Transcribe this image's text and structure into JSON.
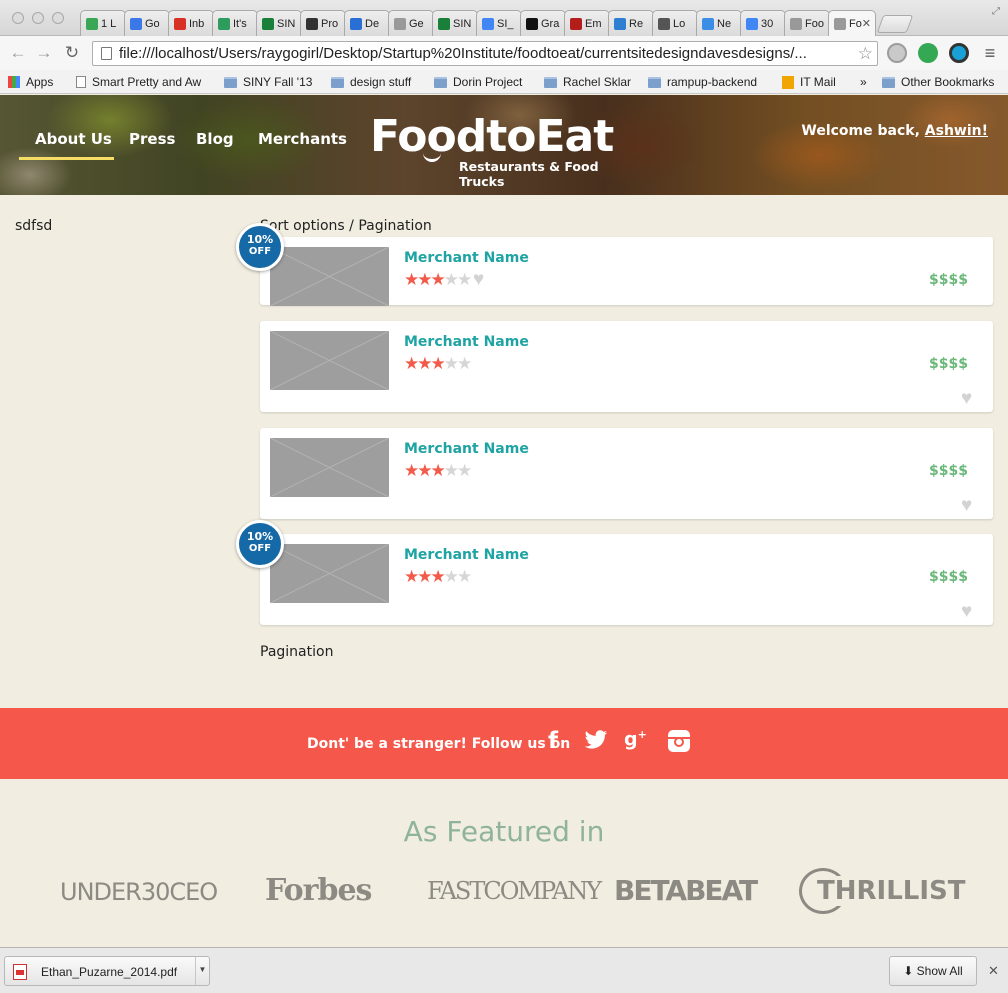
{
  "browser": {
    "tabs": [
      {
        "label": "1 L",
        "icon": "maps-icon",
        "color": "#3aa757"
      },
      {
        "label": "Go",
        "icon": "calendar-icon",
        "color": "#3b78e7"
      },
      {
        "label": "Inb",
        "icon": "gmail-icon",
        "color": "#d93025"
      },
      {
        "label": "It's",
        "icon": "app-icon",
        "color": "#2e9c5d"
      },
      {
        "label": "SIN",
        "icon": "sheets-icon",
        "color": "#188038"
      },
      {
        "label": "Pro",
        "icon": "mountain-icon",
        "color": "#333333"
      },
      {
        "label": "De",
        "icon": "drop-icon",
        "color": "#2a6fd6"
      },
      {
        "label": "Ge",
        "icon": "page-icon",
        "color": "#999999"
      },
      {
        "label": "SIN",
        "icon": "sheets-icon",
        "color": "#188038"
      },
      {
        "label": "SI_",
        "icon": "docs-icon",
        "color": "#4285f4"
      },
      {
        "label": "Gra",
        "icon": "circle-icon",
        "color": "#111111"
      },
      {
        "label": "Em",
        "icon": "flame-icon",
        "color": "#b51d1d"
      },
      {
        "label": "Re",
        "icon": "swirl-icon",
        "color": "#2e7fd1"
      },
      {
        "label": "Lo",
        "icon": "script-icon",
        "color": "#555555"
      },
      {
        "label": "Ne",
        "icon": "arrow-up-icon",
        "color": "#3b8ee6"
      },
      {
        "label": "30",
        "icon": "google-icon",
        "color": "#4285f4"
      },
      {
        "label": "Foo",
        "icon": "page-icon",
        "color": "#999999"
      },
      {
        "label": "Fo",
        "icon": "page-icon",
        "color": "#999999",
        "active": true
      }
    ],
    "url": "file:///localhost/Users/raygogirl/Desktop/Startup%20Institute/foodtoeat/currentsitedesigndavesdesigns/...",
    "bookmarks": [
      {
        "label": "Apps",
        "icon": "apps-grid-icon"
      },
      {
        "label": "Smart Pretty and Aw",
        "icon": "page-icon"
      },
      {
        "label": "SINY Fall '13",
        "icon": "folder-icon"
      },
      {
        "label": "design stuff",
        "icon": "folder-icon"
      },
      {
        "label": "Dorin Project",
        "icon": "folder-icon"
      },
      {
        "label": "Rachel Sklar",
        "icon": "folder-icon"
      },
      {
        "label": "rampup-backend",
        "icon": "folder-icon"
      },
      {
        "label": "IT Mail",
        "icon": "outlook-icon"
      },
      {
        "label": "»",
        "icon": ""
      },
      {
        "label": "Other Bookmarks",
        "icon": "folder-icon"
      }
    ]
  },
  "site": {
    "nav": [
      "About Us",
      "Press",
      "Blog",
      "Merchants"
    ],
    "logo_word": "FoodtoEat",
    "logo_sub": "Restaurants & Food Trucks",
    "welcome_prefix": "Welcome back, ",
    "welcome_user": "Ashwin!",
    "accent": "#f6de66"
  },
  "content": {
    "sidebar_text": "sdfsd",
    "sort_text": "Sort options / Pagination",
    "pagination_text": "Pagination",
    "merchants": [
      {
        "name": "Merchant Name",
        "rating": 3,
        "max_rating": 5,
        "price": "$$$$",
        "discount": true
      },
      {
        "name": "Merchant Name",
        "rating": 3,
        "max_rating": 5,
        "price": "$$$$",
        "discount": false
      },
      {
        "name": "Merchant Name",
        "rating": 3,
        "max_rating": 5,
        "price": "$$$$",
        "discount": false
      },
      {
        "name": "Merchant Name",
        "rating": 3,
        "max_rating": 5,
        "price": "$$$$",
        "discount": true
      }
    ],
    "badge_line1": "10%",
    "badge_line2": "OFF"
  },
  "social": {
    "text": "Dont' be a stranger! Follow us on",
    "icons": [
      "facebook-icon",
      "twitter-icon",
      "google-plus-icon",
      "instagram-icon"
    ],
    "color": "#f5574b"
  },
  "featured": {
    "title": "As Featured in",
    "outlets": [
      "UNDER30CEO",
      "Forbes",
      "FASTCOMPANY",
      "BETABEAT",
      "THRILLIST"
    ]
  },
  "downloads": {
    "file": "Ethan_Puzarne_2014.pdf",
    "show_all": "Show All"
  }
}
